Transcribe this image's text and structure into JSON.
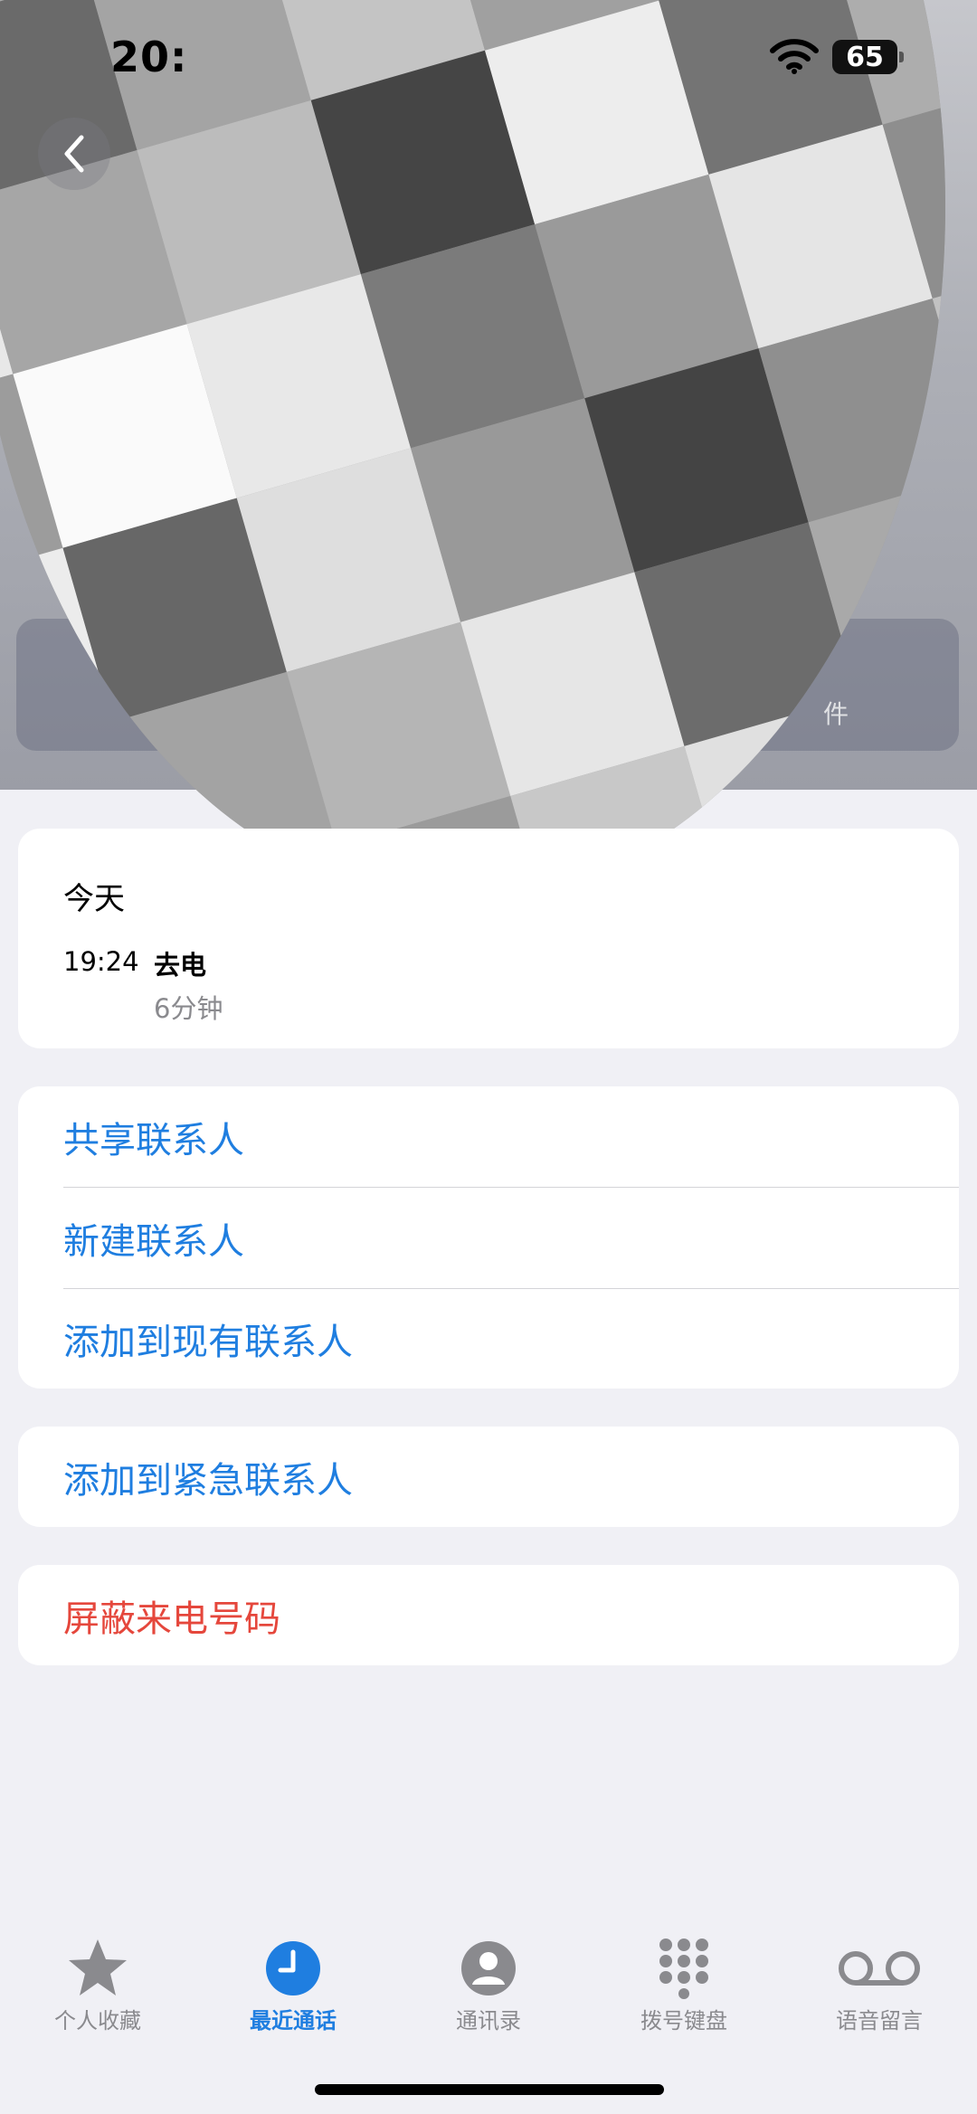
{
  "status_bar": {
    "time": "20:",
    "battery": "65",
    "icons": [
      "wifi-icon",
      "battery-icon"
    ]
  },
  "header": {
    "back_icon": "chevron-left-icon",
    "avatar": "pixelated-avatar",
    "partial_action_label": "件"
  },
  "recent_calls": {
    "day": "今天",
    "entries": [
      {
        "time": "19:24",
        "type": "去电",
        "duration": "6分钟"
      }
    ]
  },
  "actions": {
    "share_contact": "共享联系人",
    "new_contact": "新建联系人",
    "add_to_existing": "添加到现有联系人",
    "add_to_emergency": "添加到紧急联系人",
    "block_caller": "屏蔽来电号码"
  },
  "tabbar": {
    "tabs": [
      {
        "label": "个人收藏",
        "icon": "star-icon",
        "active": false
      },
      {
        "label": "最近通话",
        "icon": "clock-icon",
        "active": true
      },
      {
        "label": "通讯录",
        "icon": "contacts-icon",
        "active": false
      },
      {
        "label": "拨号键盘",
        "icon": "keypad-icon",
        "active": false
      },
      {
        "label": "语音留言",
        "icon": "voicemail-icon",
        "active": false
      }
    ]
  },
  "colors": {
    "accent": "#1f7ee0",
    "danger": "#e5473c",
    "background": "#f0f0f5",
    "secondary_text": "#8a8a8e"
  }
}
